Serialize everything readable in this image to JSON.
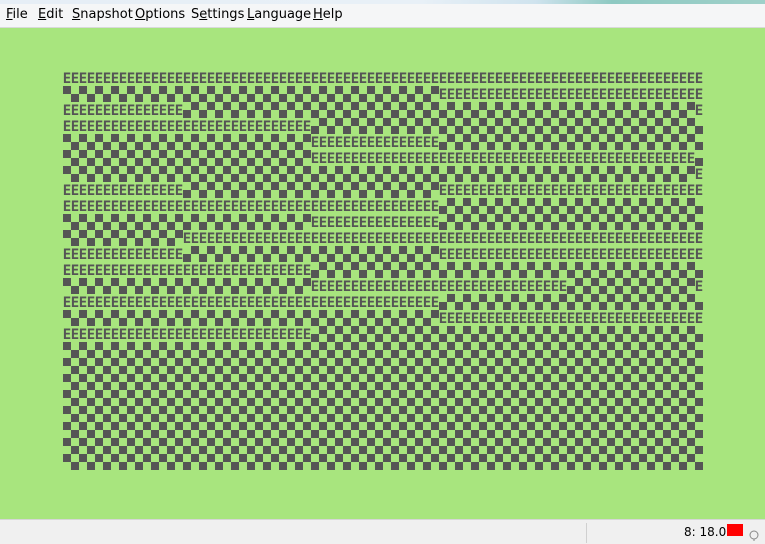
{
  "menu": {
    "items": [
      {
        "id": "file",
        "pre": "",
        "mn": "F",
        "post": "ile"
      },
      {
        "id": "edit",
        "pre": "",
        "mn": "E",
        "post": "dit"
      },
      {
        "id": "snapshot",
        "pre": "",
        "mn": "S",
        "post": "napshot"
      },
      {
        "id": "options",
        "pre": "",
        "mn": "O",
        "post": "ptions"
      },
      {
        "id": "settings",
        "pre": "S",
        "mn": "e",
        "post": "ttings"
      },
      {
        "id": "language",
        "pre": "",
        "mn": "L",
        "post": "anguage"
      },
      {
        "id": "help",
        "pre": "",
        "mn": "H",
        "post": "elp"
      }
    ]
  },
  "display": {
    "columns": 80,
    "rows": 25,
    "fill_char": "E",
    "colors": {
      "screen_bg": "#a8e57e",
      "ink": "#555555",
      "paper": "#a8e57e"
    }
  },
  "status": {
    "time": "8: 18.0",
    "indicator_color": "#ff0000"
  }
}
